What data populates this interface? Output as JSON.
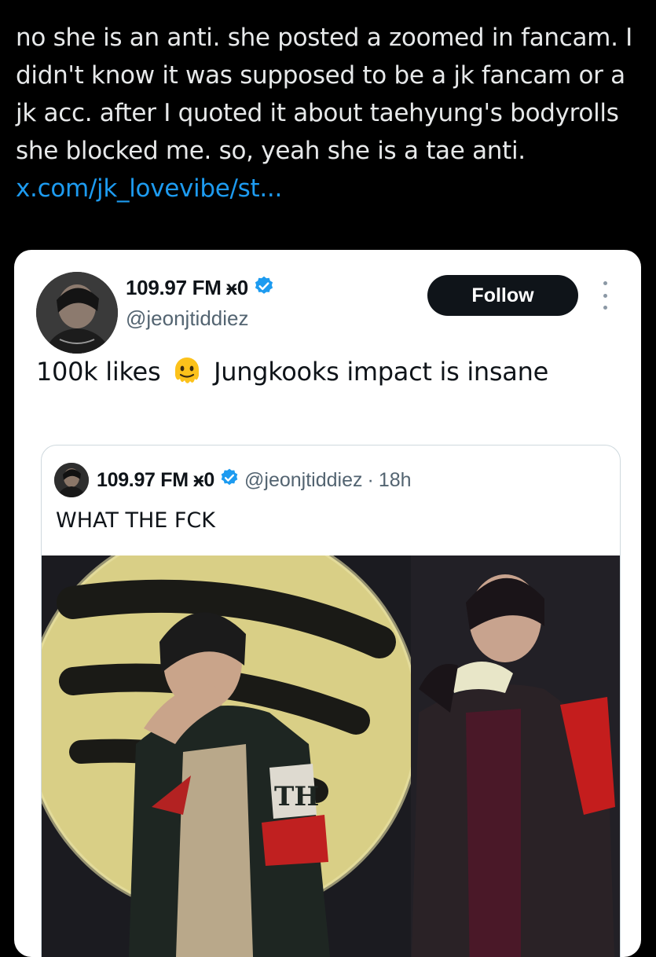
{
  "reply": {
    "text": "no she is an anti. she posted a zoomed in fancam. I didn't know it was supposed to be a jk fancam or a jk acc. after I quoted it about taehyung's bodyrolls she blocked me. so, yeah she is a tae anti. ",
    "link": "x.com/jk_lovevibe/st..."
  },
  "embedded_tweet": {
    "author_name": "109.97 FM",
    "name_symbols": "ӿ0",
    "handle": "@jeonjtiddiez",
    "follow_label": "Follow",
    "text_part1": "100k likes",
    "emoji": "melting-face-emoji",
    "text_part2": "Jungkooks impact is insane",
    "colors": {
      "verified": "#1d9bf0",
      "follow_bg": "#0f1419",
      "link": "#1d9bf0"
    }
  },
  "quoted_tweet": {
    "author_name": "109.97 FM",
    "name_symbols": "ӿ0",
    "handle": "@jeonjtiddiez",
    "dot": "·",
    "time": "18h",
    "text": "WHAT THE FCK",
    "media": "concert-photo-two-performers"
  }
}
